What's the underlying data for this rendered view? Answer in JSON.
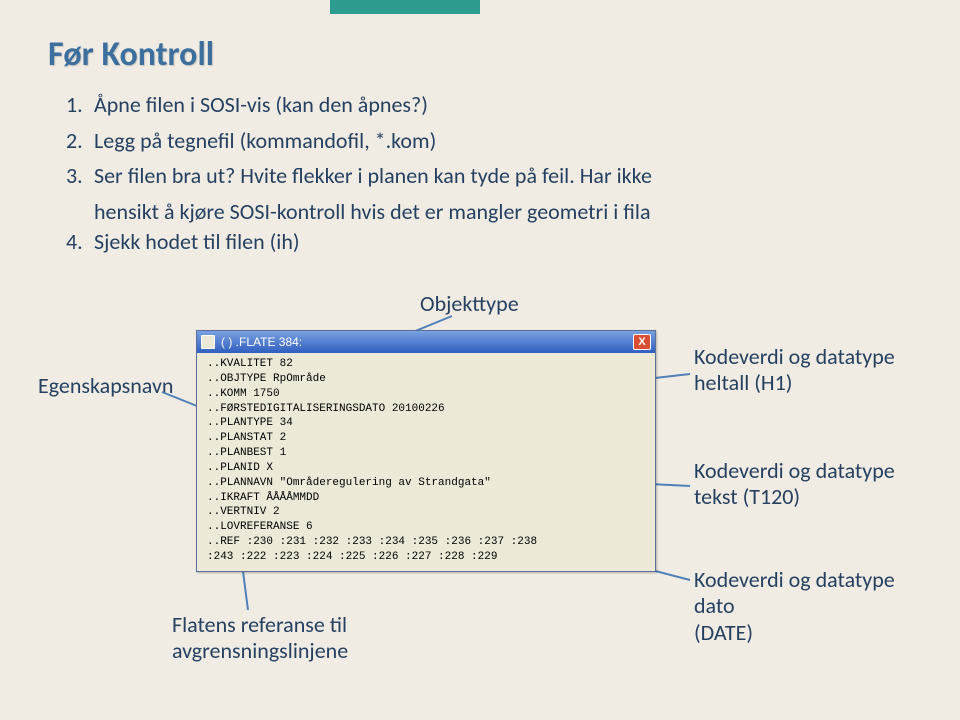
{
  "title": "Før Kontroll",
  "list": {
    "i1": "Åpne filen i SOSI-vis  (kan den åpnes?)",
    "i2": "Legg på tegnefil (kommandofil, *.kom)",
    "i3a": "Ser filen bra ut? Hvite flekker i planen kan tyde på feil. Har ikke",
    "i3b": "hensikt å kjøre SOSI-kontroll hvis det er mangler geometri i fila",
    "i4": "Sjekk hodet til filen (ih)"
  },
  "labels": {
    "objekttype": "Objekttype",
    "egenskap": "Egenskapsnavn",
    "flatens_l1": "Flatens referanse til",
    "flatens_l2": "avgrensningslinjene",
    "kvp1a": "Kodeverdi og datatype",
    "kvp1b": "heltall (H1)",
    "kvp2a": "Kodeverdi og datatype",
    "kvp2b": "tekst (T120)",
    "kvp3a": "Kodeverdi og datatype dato",
    "kvp3b": "(DATE)"
  },
  "window": {
    "title": "( ) .FLATE 384:",
    "close": "X",
    "lines": {
      "l0": "..KVALITET 82",
      "l1": "..OBJTYPE RpOmråde",
      "l2": "..KOMM 1750",
      "l3": "..FØRSTEDIGITALISERINGSDATO 20100226",
      "l4": "..PLANTYPE 34",
      "l5": "..PLANSTAT 2",
      "l6": "..PLANBEST 1",
      "l7": "..PLANID X",
      "l8": "..PLANNAVN \"Områderegulering av Strandgata\"",
      "l9": "..IKRAFT ÅÅÅÅMMDD",
      "l10": "..VERTNIV 2",
      "l11": "..LOVREFERANSE 6",
      "l12": "..REF :230 :231 :232 :233 :234 :235 :236 :237 :238",
      "l13": ":243 :222 :223 :224 :225 :226 :227 :228 :229"
    }
  }
}
